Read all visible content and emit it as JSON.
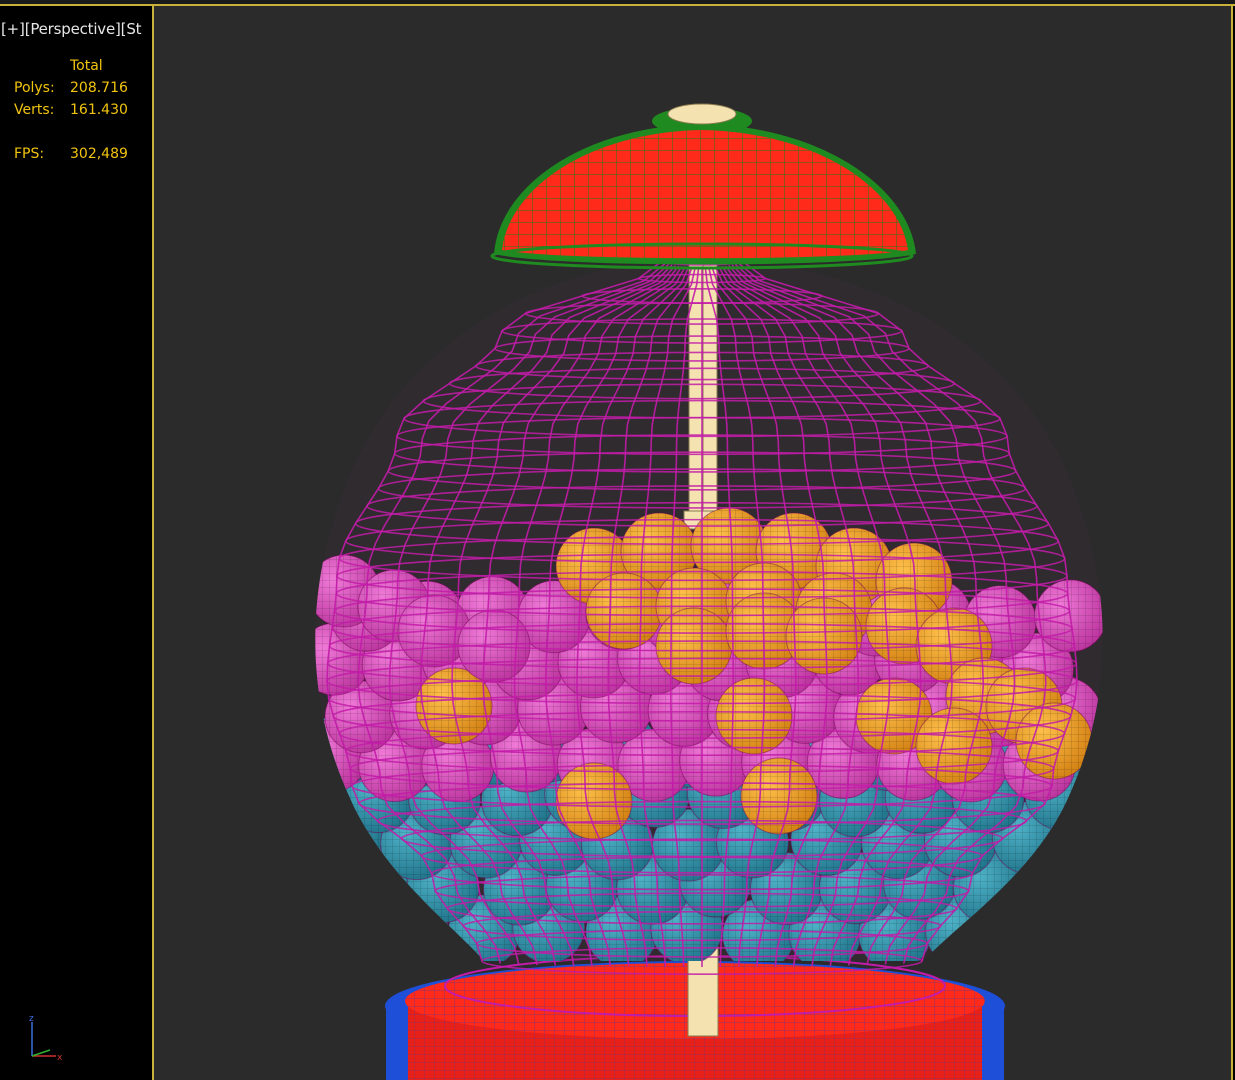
{
  "viewport": {
    "label_parts": [
      "[+]",
      "[Perspective]",
      "[St"
    ]
  },
  "stats": {
    "header": "Total",
    "polys_label": "Polys:",
    "polys_value": "208.716",
    "verts_label": "Verts:",
    "verts_value": "161.430",
    "fps_label": "FPS:",
    "fps_value": "302,489"
  },
  "gizmo": {
    "z_label": "z",
    "x_label": "x"
  },
  "colors": {
    "viewport_bg": "#2b2b2b",
    "stats_text": "#f1c40f",
    "wire_magenta": "#c21ca8",
    "lid_red": "#ff2a1a",
    "lid_green": "#1f8a1f",
    "base_blue": "#1e4fd8",
    "ball_orange": "#f2a21c",
    "ball_pink": "#e24bc6",
    "ball_teal": "#2a8fa8",
    "rod_cream": "#f4e3b0"
  }
}
